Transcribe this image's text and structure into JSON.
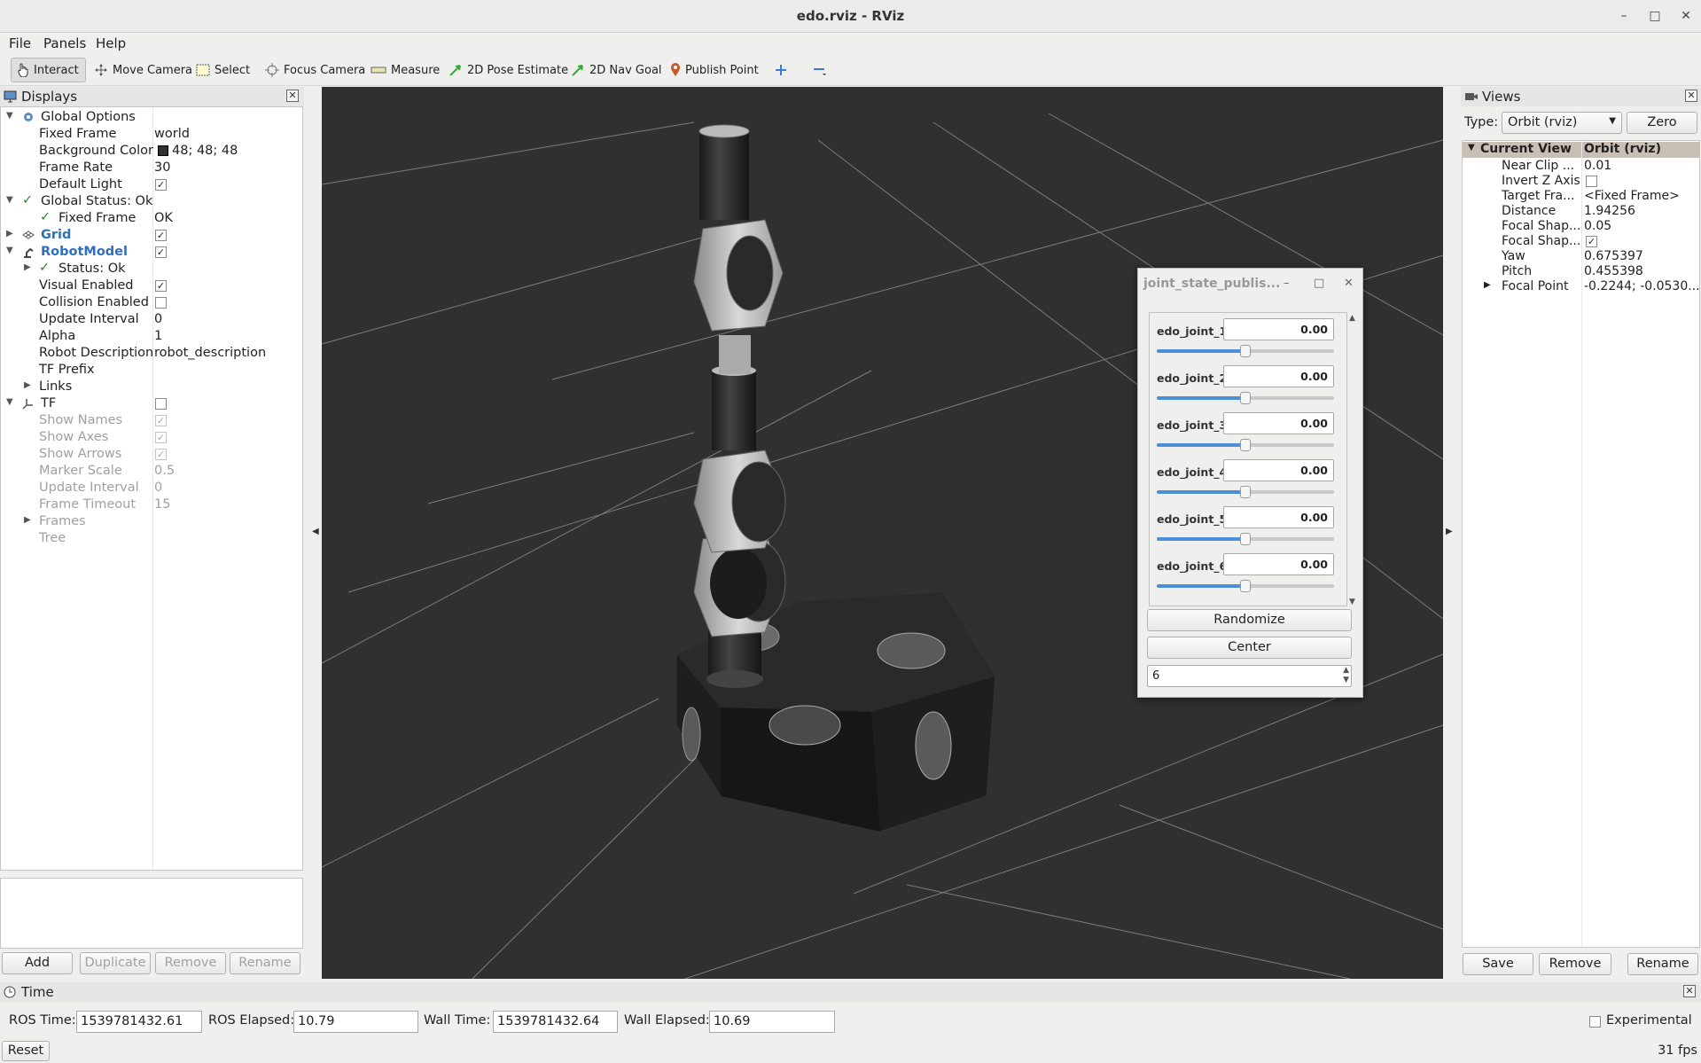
{
  "window": {
    "title": "edo.rviz - RViz"
  },
  "menu": {
    "file": "File",
    "panels": "Panels",
    "help": "Help"
  },
  "toolbar": {
    "interact": "Interact",
    "move_camera": "Move Camera",
    "select": "Select",
    "focus_camera": "Focus Camera",
    "measure": "Measure",
    "pose_estimate": "2D Pose Estimate",
    "nav_goal": "2D Nav Goal",
    "publish_point": "Publish Point"
  },
  "displays": {
    "title": "Displays",
    "global_options": "Global Options",
    "fixed_frame_label": "Fixed Frame",
    "fixed_frame_value": "world",
    "bg_color_label": "Background Color",
    "bg_color_value": "48; 48; 48",
    "bg_color_hex": "#303030",
    "frame_rate_label": "Frame Rate",
    "frame_rate_value": "30",
    "default_light_label": "Default Light",
    "global_status": "Global Status: Ok",
    "gs_fixed_frame_label": "Fixed Frame",
    "gs_fixed_frame_value": "OK",
    "grid": "Grid",
    "robot_model": "RobotModel",
    "status_ok": "Status: Ok",
    "visual_enabled": "Visual Enabled",
    "collision_enabled": "Collision Enabled",
    "update_interval_label": "Update Interval",
    "update_interval_value": "0",
    "alpha_label": "Alpha",
    "alpha_value": "1",
    "robot_desc_label": "Robot Description",
    "robot_desc_value": "robot_description",
    "tf_prefix": "TF Prefix",
    "links": "Links",
    "tf": "TF",
    "show_names": "Show Names",
    "show_axes": "Show Axes",
    "show_arrows": "Show Arrows",
    "marker_scale_label": "Marker Scale",
    "marker_scale_value": "0.5",
    "tf_update_interval_label": "Update Interval",
    "tf_update_interval_value": "0",
    "frame_timeout_label": "Frame Timeout",
    "frame_timeout_value": "15",
    "frames": "Frames",
    "tree": "Tree",
    "buttons": {
      "add": "Add",
      "duplicate": "Duplicate",
      "remove": "Remove",
      "rename": "Rename"
    }
  },
  "joint_publisher": {
    "title": "joint_state_publis...",
    "joints": [
      {
        "name": "edo_joint_1",
        "value": "0.00",
        "slider_fraction": 0.5
      },
      {
        "name": "edo_joint_2",
        "value": "0.00",
        "slider_fraction": 0.5
      },
      {
        "name": "edo_joint_3",
        "value": "0.00",
        "slider_fraction": 0.5
      },
      {
        "name": "edo_joint_4",
        "value": "0.00",
        "slider_fraction": 0.5
      },
      {
        "name": "edo_joint_5",
        "value": "0.00",
        "slider_fraction": 0.5
      },
      {
        "name": "edo_joint_6",
        "value": "0.00",
        "slider_fraction": 0.5
      }
    ],
    "randomize": "Randomize",
    "center": "Center",
    "spin_value": "6"
  },
  "views": {
    "title": "Views",
    "type_label": "Type:",
    "type_value": "Orbit (rviz)",
    "zero": "Zero",
    "current_view": "Current View",
    "current_view_value": "Orbit (rviz)",
    "props": [
      {
        "k": "Near Clip ...",
        "v": "0.01"
      },
      {
        "k": "Invert Z Axis",
        "v": ""
      },
      {
        "k": "Target Fra...",
        "v": "<Fixed Frame>"
      },
      {
        "k": "Distance",
        "v": "1.94256"
      },
      {
        "k": "Focal Shap...",
        "v": "0.05"
      },
      {
        "k": "Focal Shap...",
        "v": ""
      },
      {
        "k": "Yaw",
        "v": "0.675397"
      },
      {
        "k": "Pitch",
        "v": "0.455398"
      },
      {
        "k": "Focal Point",
        "v": "-0.2244; -0.0530..."
      }
    ],
    "buttons": {
      "save": "Save",
      "remove": "Remove",
      "rename": "Rename"
    }
  },
  "time": {
    "title": "Time",
    "ros_time_label": "ROS Time:",
    "ros_time": "1539781432.61",
    "ros_elapsed_label": "ROS Elapsed:",
    "ros_elapsed": "10.79",
    "wall_time_label": "Wall Time:",
    "wall_time": "1539781432.64",
    "wall_elapsed_label": "Wall Elapsed:",
    "wall_elapsed": "10.69",
    "experimental": "Experimental",
    "reset": "Reset",
    "fps": "31 fps"
  }
}
